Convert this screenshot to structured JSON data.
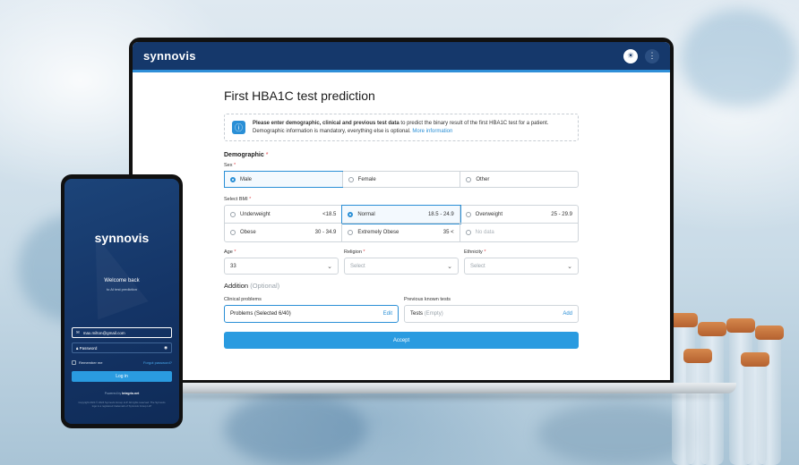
{
  "laptop_app": {
    "logo": "synnovis",
    "header_icons": [
      "sun-icon",
      "more-vertical-icon"
    ],
    "page_title": "First HBA1C test prediction",
    "info": {
      "bold": "Please enter demographic, clinical and previous test data",
      "text": " to predict the binary result of the first HBA1C test for a patient.",
      "line2": "Demographic information is mandatory, everything else is optional.",
      "link": "More information"
    },
    "demographic_title": "Demographic",
    "sex": {
      "label": "Sex",
      "options": [
        "Male",
        "Female",
        "Other"
      ],
      "selected": "Male"
    },
    "bmi": {
      "label": "Select BMI",
      "options": [
        {
          "label": "Underweight",
          "range": "<18.5"
        },
        {
          "label": "Normal",
          "range": "18.5 - 24.9"
        },
        {
          "label": "Overweight",
          "range": "25 - 29.9"
        },
        {
          "label": "Obese",
          "range": "30 - 34.9"
        },
        {
          "label": "Extremely Obese",
          "range": "35 <"
        },
        {
          "label": "No data",
          "range": ""
        }
      ],
      "selected": "Normal"
    },
    "age": {
      "label": "Age",
      "value": "33"
    },
    "religion": {
      "label": "Religion",
      "placeholder": "Select"
    },
    "ethnicity": {
      "label": "Ethnicity",
      "placeholder": "Select"
    },
    "addition_title": "Addition",
    "addition_optional": "(Optional)",
    "clinical": {
      "label": "Clinical problems",
      "name": "Problems",
      "count": "(Selected 6/40)",
      "action": "Edit"
    },
    "previous": {
      "label": "Previous known tests",
      "name": "Tests",
      "count": "(Empty)",
      "action": "Add"
    },
    "accept_label": "Accept",
    "colors": {
      "primary": "#2a9be0",
      "header": "#15386b",
      "required": "#e0474c"
    }
  },
  "phone_app": {
    "logo": "synnovis",
    "welcome": "Welcome back",
    "subtitle": "to AI test prediction",
    "email_value": "max.milton@gmail.com",
    "password_label": "Password",
    "remember": "Remember me",
    "forgot": "Forgot password?",
    "login": "Log in",
    "powered_prefix": "Powered by",
    "powered_brand": "Integrio.net",
    "copyright": "Copyright 2024 © 2024 Synnovis Group LLP. All rights reserved. The Synnovis logo is a registered trademark of Synnovis Group LLP"
  }
}
